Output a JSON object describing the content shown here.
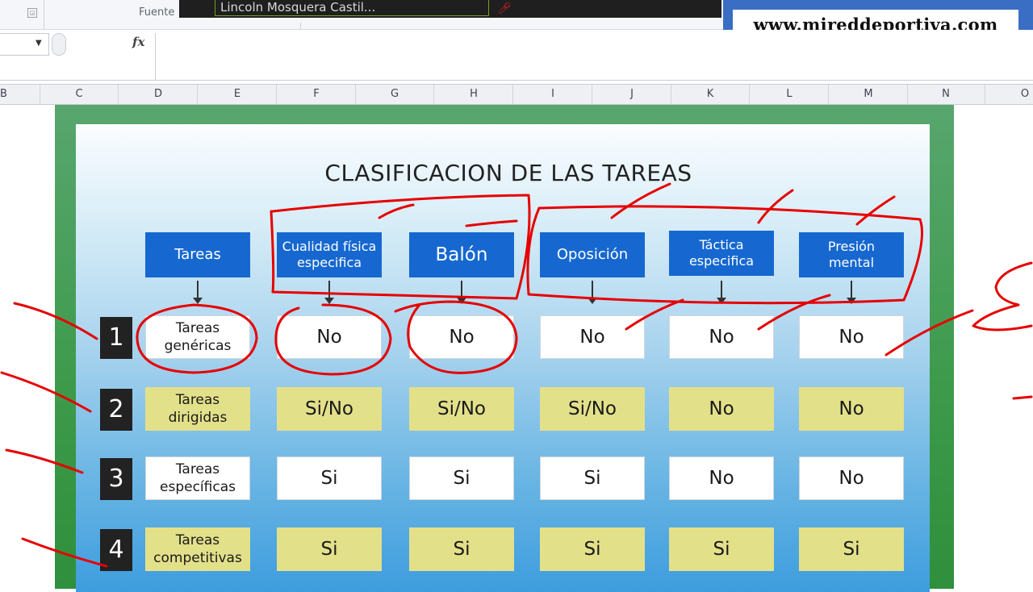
{
  "ribbon": {
    "group_label": "Fuente",
    "launcher_icon": "dialog-launcher-icon"
  },
  "overlay": {
    "name": "Lincoln Mosquera Castil..."
  },
  "banner": {
    "text": "www.mireddeportiva.com"
  },
  "formula_bar": {
    "fx_label": "fx"
  },
  "columns": [
    "B",
    "C",
    "D",
    "E",
    "F",
    "G",
    "H",
    "I",
    "J",
    "K",
    "L",
    "M",
    "N",
    "O"
  ],
  "slide": {
    "title": "CLASIFICACION DE LAS TAREAS",
    "headers": [
      "Tareas",
      "Cualidad física\nespecifica",
      "Balón",
      "Oposición",
      "Táctica\nespecifica",
      "Presión\nmental"
    ],
    "rows": [
      {
        "num": "1",
        "label": "Tareas\ngenéricas",
        "values": [
          "No",
          "No",
          "No",
          "No",
          "No"
        ],
        "style": "white"
      },
      {
        "num": "2",
        "label": "Tareas\ndirigidas",
        "values": [
          "Si/No",
          "Si/No",
          "Si/No",
          "No",
          "No"
        ],
        "style": "yellow"
      },
      {
        "num": "3",
        "label": "Tareas\nespecíficas",
        "values": [
          "Si",
          "Si",
          "Si",
          "No",
          "No"
        ],
        "style": "white"
      },
      {
        "num": "4",
        "label": "Tareas\ncompetitivas",
        "values": [
          "Si",
          "Si",
          "Si",
          "Si",
          "Si"
        ],
        "style": "yellow"
      }
    ]
  },
  "colors": {
    "header_blue": "#1668d0",
    "yellow_cell": "#e3e08a",
    "ink_red": "#e60000",
    "frame_green": "#3c9a4a",
    "banner_blue": "#3a6ec4"
  }
}
